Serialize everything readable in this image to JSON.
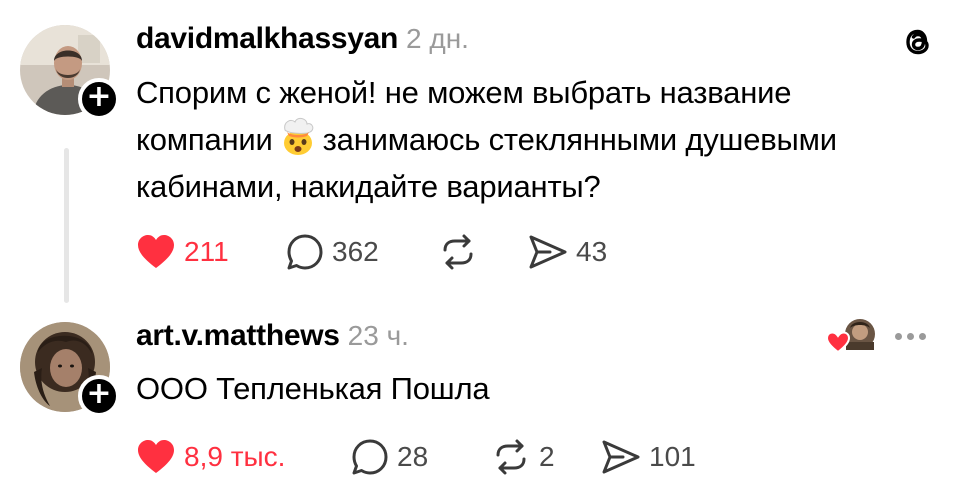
{
  "app": {
    "logo_icon": "threads-logo-icon"
  },
  "colors": {
    "like_red": "#ff3040",
    "muted_gray": "#9a9a9a",
    "thread_line": "#e6e6e6"
  },
  "posts": [
    {
      "username": "davidmalkhassyan",
      "time": "2 дн.",
      "text_before_emoji": "Спорим с женой! не можем выбрать название компании",
      "emoji": "exploding-head-emoji",
      "text_after_emoji": "занимаюсь стеклянными душевыми кабинами, накидайте варианты?",
      "likes": "211",
      "liked": true,
      "replies": "362",
      "reposts": "",
      "shares": "43"
    },
    {
      "username": "art.v.matthews",
      "time": "23 ч.",
      "text": "ООО Тепленькая Пошла",
      "likes": "8,9 тыс.",
      "liked": true,
      "replies": "28",
      "reposts": "2",
      "shares": "101"
    }
  ]
}
